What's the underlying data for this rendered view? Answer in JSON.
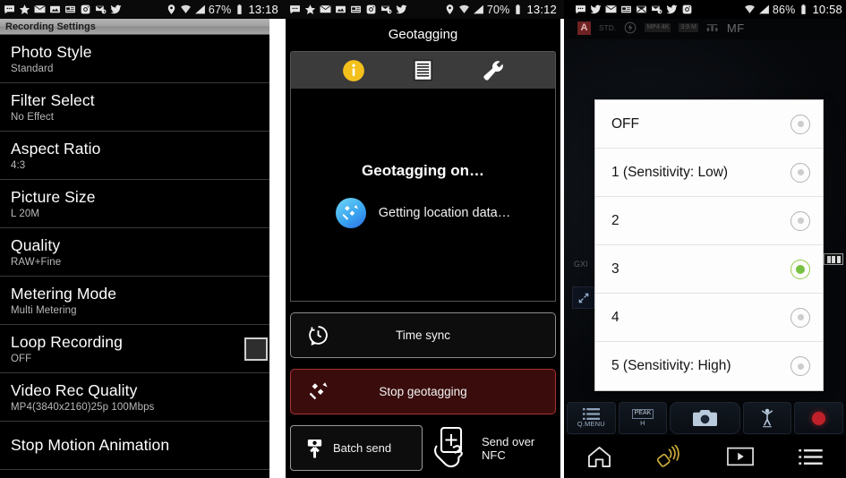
{
  "panel1": {
    "statusbar": {
      "icons": [
        "messages-icon",
        "star-icon",
        "mail-icon",
        "photo-icon",
        "news-icon",
        "instagram-icon",
        "email-sync-icon",
        "twitter-icon"
      ],
      "location_icon": "location-pin-icon",
      "wifi_icon": "wifi-icon",
      "signal_icon": "signal-bars-icon",
      "battery_text": "67%",
      "battery_icon": "battery-icon",
      "time": "13:18"
    },
    "header_title": "Recording Settings",
    "rows": [
      {
        "title": "Photo Style",
        "sub": "Standard",
        "checkbox": false
      },
      {
        "title": "Filter Select",
        "sub": "No Effect",
        "checkbox": false
      },
      {
        "title": "Aspect Ratio",
        "sub": "4:3",
        "checkbox": false
      },
      {
        "title": "Picture Size",
        "sub": "L 20M",
        "checkbox": false
      },
      {
        "title": "Quality",
        "sub": "RAW+Fine",
        "checkbox": false
      },
      {
        "title": "Metering Mode",
        "sub": "Multi Metering",
        "checkbox": false
      },
      {
        "title": "Loop Recording",
        "sub": "OFF",
        "checkbox": true
      },
      {
        "title": "Video Rec Quality",
        "sub": "MP4(3840x2160)25p 100Mbps",
        "checkbox": false
      },
      {
        "title": "Stop Motion Animation",
        "sub": "",
        "checkbox": false
      }
    ]
  },
  "panel2": {
    "statusbar": {
      "icons": [
        "messages-icon",
        "star-icon",
        "mail-icon",
        "photo-icon",
        "news-icon",
        "instagram-icon",
        "email-sync-icon",
        "twitter-icon"
      ],
      "location_icon": "location-pin-icon",
      "wifi_icon": "wifi-icon",
      "signal_icon": "signal-bars-icon",
      "battery_text": "70%",
      "battery_icon": "battery-icon",
      "time": "13:12"
    },
    "title": "Geotagging",
    "tabs": [
      {
        "name": "info-tab",
        "icon": "info-icon",
        "active": true
      },
      {
        "name": "log-tab",
        "icon": "list-document-icon",
        "active": false
      },
      {
        "name": "settings-tab",
        "icon": "wrench-icon",
        "active": false
      }
    ],
    "stage": {
      "title": "Geotagging on…",
      "status": "Getting location data…",
      "icon": "satellite-icon"
    },
    "buttons": {
      "time_sync": {
        "label": "Time sync",
        "icon": "clock-sync-icon"
      },
      "stop_geotagging": {
        "label": "Stop geotagging",
        "icon": "satellite-stop-icon"
      },
      "batch_send": {
        "label": "Batch send",
        "icon": "camera-upload-icon"
      },
      "send_over_nfc": {
        "label": "Send over NFC",
        "icon": "nfc-hand-icon"
      }
    },
    "colors": {
      "stop_bg": "#3a0c0c",
      "stop_border": "#aa3333",
      "accent": "#f5c324"
    }
  },
  "panel3": {
    "statusbar": {
      "icons": [
        "messages-icon",
        "twitter-icon",
        "mail-icon",
        "news-icon",
        "envelope-icon",
        "email-sync-icon",
        "twitter-icon",
        "instagram-icon"
      ],
      "wifi_icon": "wifi-icon",
      "signal_icon": "signal-bars-icon",
      "battery_text": "86%",
      "battery_icon": "battery-icon",
      "time": "10:58"
    },
    "camera_status": {
      "mode_badge": "A",
      "stabilizer": "STD.",
      "flash_icon": "flash-off-icon",
      "rec_format": "MP4 4K",
      "picture_size": "3:9 M",
      "quality_icon": "quality-icon",
      "focus_mode": "MF",
      "lens_label": "GXI",
      "corner_icon": "expand-corner-icon",
      "battery_icon": "camera-battery-icon"
    },
    "dialog": {
      "name": "sensitivity-options-dialog",
      "options": [
        {
          "label": "OFF",
          "selected": false
        },
        {
          "label": "1 (Sensitivity: Low)",
          "selected": false
        },
        {
          "label": "2",
          "selected": false
        },
        {
          "label": "3",
          "selected": true
        },
        {
          "label": "4",
          "selected": false
        },
        {
          "label": "5 (Sensitivity: High)",
          "selected": false
        }
      ],
      "selected_color": "#77c043"
    },
    "toolbar": [
      {
        "name": "q-menu-button",
        "label": "Q.MENU",
        "icon": "menu-lines-icon"
      },
      {
        "name": "peaking-button",
        "label": "H",
        "icon": "peak-icon",
        "badge": "PEAK"
      },
      {
        "name": "shutter-button",
        "label": "",
        "icon": "camera-icon"
      },
      {
        "name": "scene-button",
        "label": "",
        "icon": "person-jump-icon"
      },
      {
        "name": "record-button",
        "label": "",
        "icon": "record-dot-icon"
      }
    ],
    "navbar": [
      {
        "name": "home-nav-button",
        "icon": "home-icon"
      },
      {
        "name": "wifi-remote-nav-button",
        "icon": "wifi-remote-icon"
      },
      {
        "name": "playback-nav-button",
        "icon": "play-icon"
      },
      {
        "name": "menu-nav-button",
        "icon": "list-menu-icon"
      }
    ]
  }
}
